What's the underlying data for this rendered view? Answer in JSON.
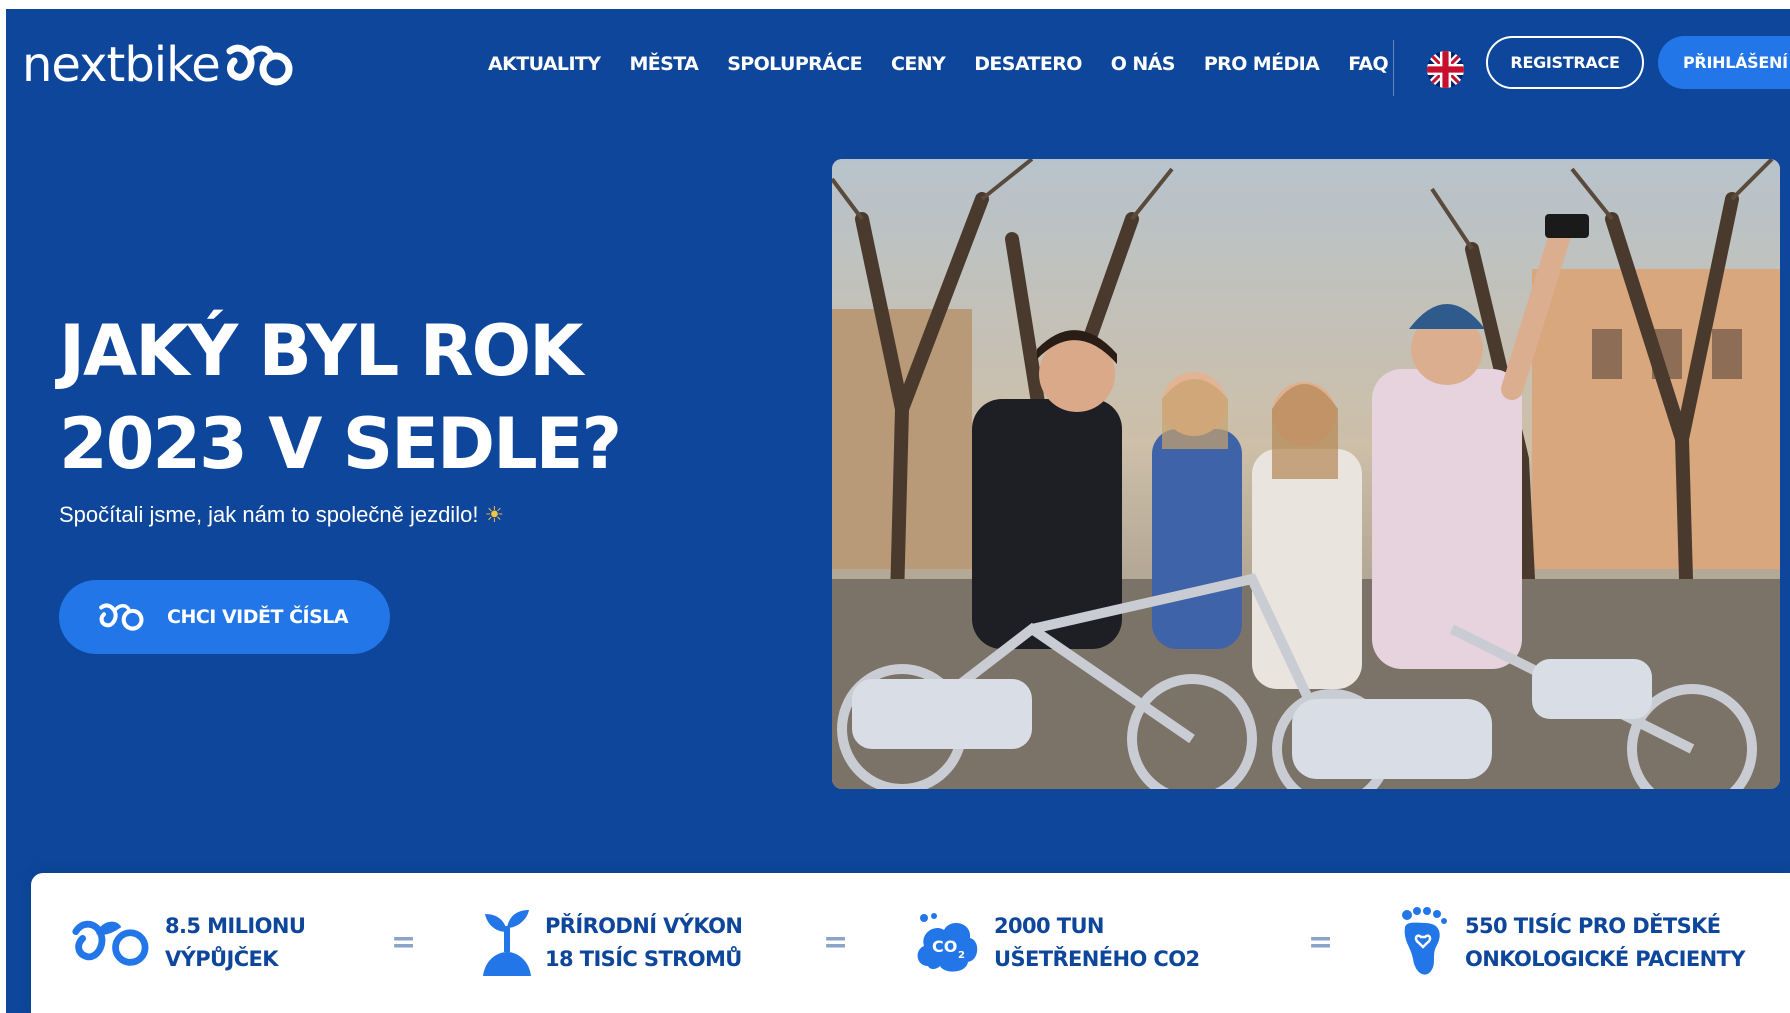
{
  "header": {
    "logo_text": "nextbike",
    "nav": [
      "AKTUALITY",
      "MĚSTA",
      "SPOLUPRÁCE",
      "CENY",
      "DESATERO",
      "O NÁS",
      "PRO MÉDIA",
      "FAQ"
    ],
    "language_icon": "uk-flag-icon",
    "register_label": "REGISTRACE",
    "login_label": "PŘIHLÁŠENÍ"
  },
  "hero": {
    "title_line1": "JAKÝ BYL ROK",
    "title_line2": "2023 V SEDLE?",
    "subtitle": "Spočítali jsme, jak nám to společně jezdilo!",
    "subtitle_icon": "sun-icon",
    "cta_label": "CHCI VIDĚT ČÍSLA",
    "cta_icon": "bike-logo-icon",
    "photo": "group-selfie-with-bikes-photo"
  },
  "stats": [
    {
      "icon": "bike-logo-icon",
      "line1": "8.5 MILIONU",
      "line2": "VÝPŮJČEK"
    },
    {
      "icon": "tree-sprout-icon",
      "line1": "PŘÍRODNÍ VÝKON",
      "line2": "18 TISÍC STROMŮ"
    },
    {
      "icon": "co2-cloud-icon",
      "line1": "2000 TUN",
      "line2": "UŠETŘENÉHO CO2"
    },
    {
      "icon": "heart-foot-icon",
      "line1": "550 TISÍC PRO DĚTSKÉ",
      "line2": "ONKOLOGICKÉ PACIENTY"
    }
  ],
  "equals_symbol": "=",
  "colors": {
    "hero_bg": "#0d469a",
    "accent": "#2276e8",
    "white": "#ffffff",
    "stat_text": "#0d469a"
  }
}
